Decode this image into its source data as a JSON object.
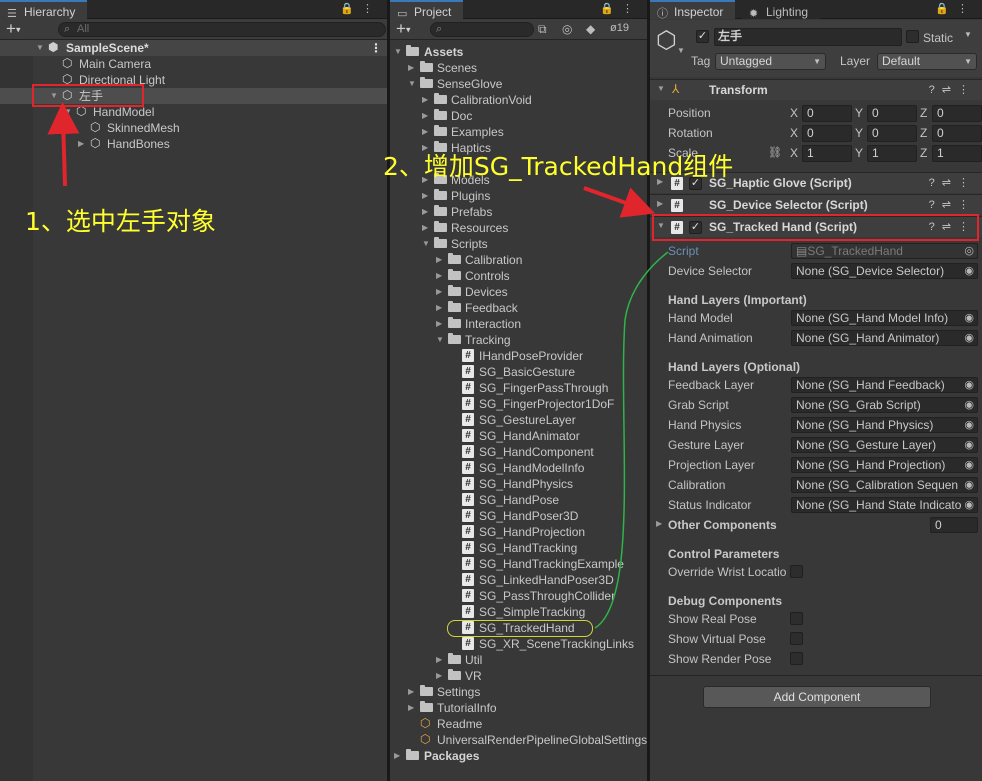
{
  "hierarchy": {
    "tab": "Hierarchy",
    "search_placeholder": "All",
    "scene": "SampleScene*",
    "items": [
      "Main Camera",
      "Directional Light",
      "左手",
      "HandModel",
      "SkinnedMesh",
      "HandBones"
    ]
  },
  "project": {
    "tab": "Project",
    "hidden_count": "19",
    "tree": [
      "Assets",
      "Scenes",
      "SenseGlove",
      "CalibrationVoid",
      "Doc",
      "Examples",
      "Haptics",
      "Models",
      "Plugins",
      "Prefabs",
      "Resources",
      "Scripts",
      "Calibration",
      "Controls",
      "Devices",
      "Feedback",
      "Interaction",
      "Tracking"
    ],
    "scripts": [
      "IHandPoseProvider",
      "SG_BasicGesture",
      "SG_FingerPassThrough",
      "SG_FingerProjector1DoF",
      "SG_GestureLayer",
      "SG_HandAnimator",
      "SG_HandComponent",
      "SG_HandModelInfo",
      "SG_HandPhysics",
      "SG_HandPose",
      "SG_HandPoser3D",
      "SG_HandProjection",
      "SG_HandTracking",
      "SG_HandTrackingExample",
      "SG_LinkedHandPoser3D",
      "SG_PassThroughCollider",
      "SG_SimpleTracking",
      "SG_TrackedHand",
      "SG_XR_SceneTrackingLinks"
    ],
    "tail": [
      "Util",
      "VR",
      "Settings",
      "TutorialInfo",
      "Readme",
      "UniversalRenderPipelineGlobalSettings",
      "Packages"
    ]
  },
  "inspector": {
    "tabs": [
      "Inspector",
      "Lighting"
    ],
    "object_name": "左手",
    "static_label": "Static",
    "tag_label": "Tag",
    "tag_value": "Untagged",
    "layer_label": "Layer",
    "layer_value": "Default",
    "transform": {
      "title": "Transform",
      "rows": [
        {
          "label": "Position",
          "x": "0",
          "y": "0",
          "z": "0"
        },
        {
          "label": "Rotation",
          "x": "0",
          "y": "0",
          "z": "0"
        },
        {
          "label": "Scale",
          "x": "1",
          "y": "1",
          "z": "1"
        }
      ],
      "axes": [
        "X",
        "Y",
        "Z"
      ]
    },
    "components": [
      "SG_Haptic Glove (Script)",
      "SG_Device Selector (Script)",
      "SG_Tracked Hand (Script)"
    ],
    "script_label": "Script",
    "script_value": "SG_TrackedHand",
    "device_selector": {
      "label": "Device Selector",
      "value": "None (SG_Device Selector)"
    },
    "sections": [
      "Hand Layers (Important)",
      "Hand Layers (Optional)",
      "Control Parameters",
      "Debug Components"
    ],
    "important": [
      {
        "label": "Hand Model",
        "value": "None (SG_Hand Model Info)"
      },
      {
        "label": "Hand Animation",
        "value": "None (SG_Hand Animator)"
      }
    ],
    "optional": [
      {
        "label": "Feedback Layer",
        "value": "None (SG_Hand Feedback)"
      },
      {
        "label": "Grab Script",
        "value": "None (SG_Grab Script)"
      },
      {
        "label": "Hand Physics",
        "value": "None (SG_Hand Physics)"
      },
      {
        "label": "Gesture Layer",
        "value": "None (SG_Gesture Layer)"
      },
      {
        "label": "Projection Layer",
        "value": "None (SG_Hand Projection)"
      },
      {
        "label": "Calibration",
        "value": "None (SG_Calibration Sequen"
      },
      {
        "label": "Status Indicator",
        "value": "None (SG_Hand State Indicato"
      }
    ],
    "other_components": {
      "label": "Other Components",
      "value": "0"
    },
    "override_wrist": "Override Wrist Locatio",
    "debug": [
      "Show Real Pose",
      "Show Virtual Pose",
      "Show Render Pose"
    ],
    "add_component": "Add Component"
  },
  "annotations": {
    "step1": "1、选中左手对象",
    "step2": "2、增加SG_TrackedHand组件"
  },
  "colors": {
    "highlight": "#e0262c",
    "annotation": "#ffff2e",
    "link_line": "#2fb34a",
    "selected_outline": "#d4d43a"
  }
}
